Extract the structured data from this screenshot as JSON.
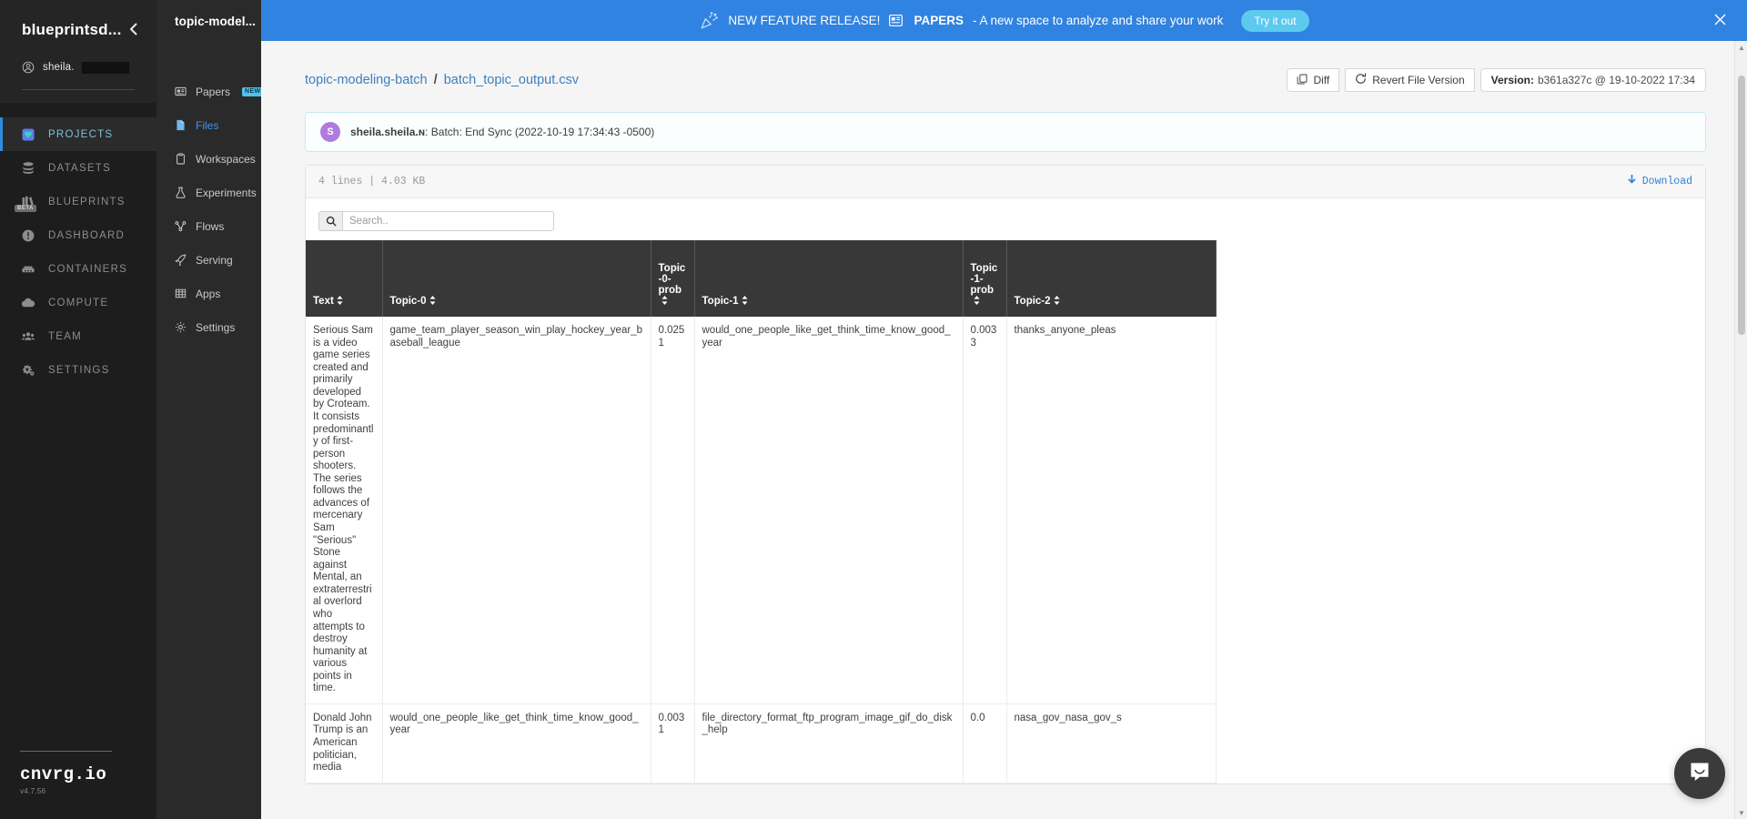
{
  "rail": {
    "brand": "blueprintsd...",
    "collapse_icon": "chevron-left-icon",
    "user": "sheila.",
    "items": [
      {
        "label": "PROJECTS",
        "icon": "projects-icon",
        "active": true
      },
      {
        "label": "DATASETS",
        "icon": "datasets-icon",
        "active": false
      },
      {
        "label": "BLUEPRINTS",
        "icon": "blueprints-icon",
        "active": false,
        "badge": "BETA"
      },
      {
        "label": "DASHBOARD",
        "icon": "dashboard-icon",
        "active": false
      },
      {
        "label": "CONTAINERS",
        "icon": "containers-icon",
        "active": false
      },
      {
        "label": "COMPUTE",
        "icon": "compute-icon",
        "active": false
      },
      {
        "label": "TEAM",
        "icon": "team-icon",
        "active": false
      },
      {
        "label": "SETTINGS",
        "icon": "settings-icon",
        "active": false
      }
    ],
    "logo": "cnvrg.io",
    "version": "v4.7.56"
  },
  "subnav": {
    "title": "topic-model...",
    "items": [
      {
        "label": "Papers",
        "icon": "papers-icon",
        "badge": "NEW",
        "active": false
      },
      {
        "label": "Files",
        "icon": "file-icon",
        "active": true
      },
      {
        "label": "Workspaces",
        "icon": "clipboard-icon",
        "active": false
      },
      {
        "label": "Experiments",
        "icon": "flask-icon",
        "active": false
      },
      {
        "label": "Flows",
        "icon": "flows-icon",
        "active": false
      },
      {
        "label": "Serving",
        "icon": "rocket-icon",
        "active": false
      },
      {
        "label": "Apps",
        "icon": "grid-icon",
        "active": false
      },
      {
        "label": "Settings",
        "icon": "gear-icon",
        "active": false
      }
    ]
  },
  "banner": {
    "party_icon": "party-popper-icon",
    "headline": "NEW FEATURE RELEASE!",
    "papers_icon": "papers-icon",
    "papers_label": "PAPERS",
    "tagline": "- A new space to analyze and share your work",
    "cta": "Try it out",
    "close_icon": "close-icon",
    "bg_color": "#3083e0",
    "cta_color": "#5ec9ef"
  },
  "breadcrumb": {
    "project": "topic-modeling-batch",
    "separator": "/",
    "file": "batch_topic_output.csv"
  },
  "toolbar": {
    "diff_label": "Diff",
    "diff_icon": "copy-icon",
    "revert_label": "Revert File Version",
    "revert_icon": "refresh-icon",
    "version_key": "Version:",
    "version_value": "b361a327c @ 19-10-2022 17:34"
  },
  "commit": {
    "avatar_letter": "S",
    "avatar_color": "#b07ae0",
    "author": "sheila.sheila.ɴ",
    "message": ": Batch: End Sync (2022-10-19 17:34:43 -0500)"
  },
  "file_info": {
    "meta": "4 lines  |  4.03 KB",
    "download_label": "Download",
    "download_icon": "download-arrow-icon"
  },
  "search": {
    "placeholder": "Search..",
    "value": "",
    "icon": "search-icon"
  },
  "table": {
    "sort_icon": "sort-updown-icon",
    "columns": [
      {
        "label": "Text",
        "key": "text"
      },
      {
        "label": "Topic-0",
        "key": "topic0"
      },
      {
        "label": "Topic-0-prob",
        "key": "topic0prob"
      },
      {
        "label": "Topic-1",
        "key": "topic1"
      },
      {
        "label": "Topic-1-prob",
        "key": "topic1prob"
      },
      {
        "label": "Topic-2",
        "key": "topic2"
      }
    ],
    "rows": [
      {
        "text": "Serious Sam is a video game series created and primarily developed by Croteam. It consists predominantly of first-person shooters. The series follows the advances of mercenary Sam \"Serious\" Stone against Mental, an extraterrestrial overlord who attempts to destroy humanity at various points in time.",
        "topic0": "game_team_player_season_win_play_hockey_year_baseball_league",
        "topic0prob": "0.0251",
        "topic1": "would_one_people_like_get_think_time_know_good_year",
        "topic1prob": "0.0033",
        "topic2": "thanks_anyone_pleas"
      },
      {
        "text": "Donald John Trump is an American politician, media",
        "topic0": "would_one_people_like_get_think_time_know_good_year",
        "topic0prob": "0.0031",
        "topic1": "file_directory_format_ftp_program_image_gif_do_disk_help",
        "topic1prob": "0.0",
        "topic2": "nasa_gov_nasa_gov_s"
      }
    ]
  },
  "intercom": {
    "icon": "chat-bubble-icon"
  },
  "scrollbar": {
    "up_icon": "caret-up-icon",
    "down_icon": "caret-down-icon"
  }
}
